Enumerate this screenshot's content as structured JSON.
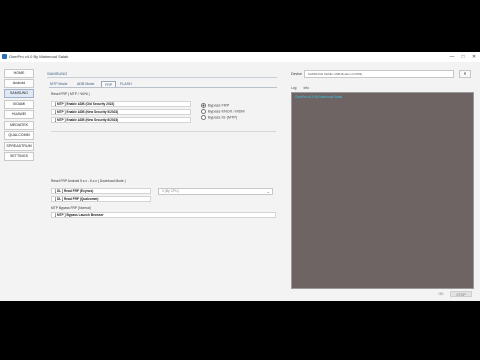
{
  "window": {
    "title": "GsmPro v4.0 By Mahmoud Salah",
    "minimize": "—",
    "maximize": "□",
    "close": "✕"
  },
  "sidebar": {
    "items": [
      {
        "label": "HOME",
        "active": false
      },
      {
        "label": "Android",
        "active": false
      },
      {
        "label": "SAMSUNG",
        "active": true
      },
      {
        "label": "XIOAMI",
        "active": false
      },
      {
        "label": "HUAWEI",
        "active": false
      },
      {
        "label": "MEDIATEK",
        "active": false
      },
      {
        "label": "QUALCOMM",
        "active": false
      },
      {
        "label": "SPREADTRUM",
        "active": false
      },
      {
        "label": "SETTINGS",
        "active": false
      }
    ]
  },
  "main": {
    "top_tab": "SAMSUNG",
    "sub_tabs": [
      "MTP Mode",
      "ADB Mode",
      "FRP",
      "FLASH"
    ],
    "active_sub_tab": "FRP",
    "group1_label": "Reset FRP ( MTP / *#0*# )",
    "group1_ops": [
      "[ MTP ] Enable ADB (Old Security 2022)",
      "[ MTP ] Enable ADB (New Security 5/2023)",
      "[ MTP ] Enable ADB (New Security 8/2023)"
    ],
    "radios": [
      {
        "label": "Bypass FRP",
        "checked": true
      },
      {
        "label": "Bypass KNOX / MDM",
        "checked": false
      },
      {
        "label": "Bypass IG (MTP)",
        "checked": false
      }
    ],
    "group2_label": "Reset FRP Android 5.x.x - 6.x.x ( Download Mode )",
    "group2_ops": [
      "[ DL ] Read FRP (Exynos)",
      "[ DL ] Read FRP (Qualcomm)"
    ],
    "combo_value": "0 (By CPU)",
    "group3_label": "MTP Bypass FRP (Normal)",
    "group3_ops": [
      "[ MTP ] Bypass Launch Browser"
    ]
  },
  "right": {
    "device_label": "Device",
    "device_value": "SAMSUNG Mobile USB Modem (COM3)",
    "refresh": "R",
    "log_tabs": [
      "Log",
      "Info"
    ],
    "log_text": "GsmPro v4.0 By Mahmoud Salah",
    "ok_label": "OK",
    "stop_label": "STOP"
  }
}
